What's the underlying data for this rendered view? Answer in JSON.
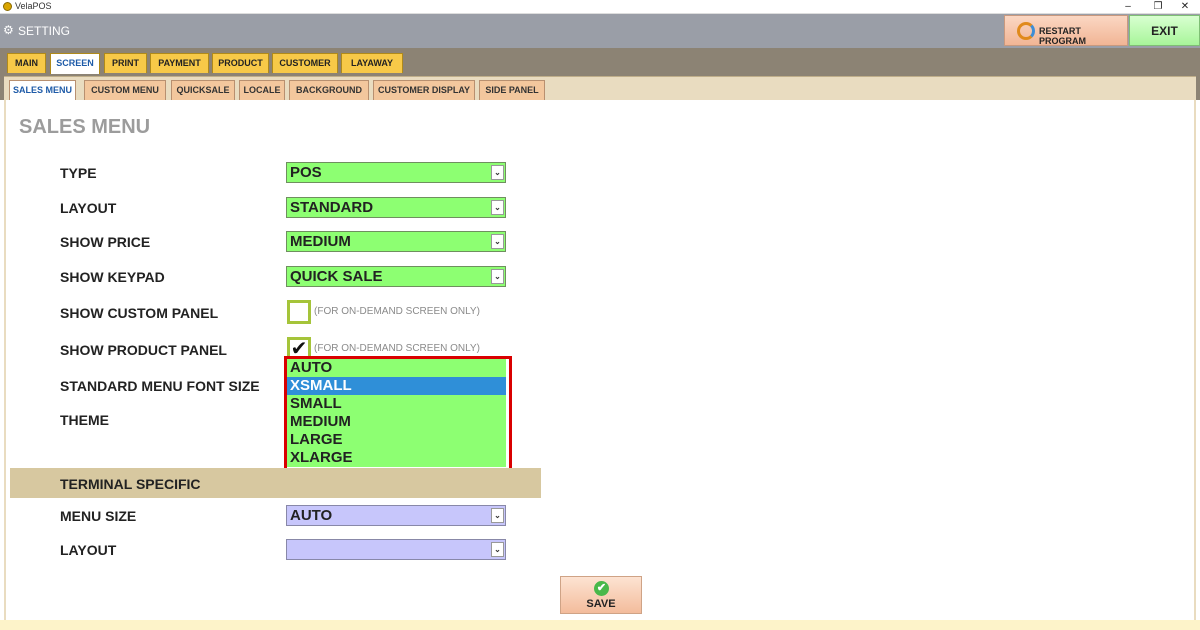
{
  "window": {
    "title": "VelaPOS"
  },
  "header": {
    "title": "SETTING",
    "restart_label": "RESTART PROGRAM",
    "exit_label": "EXIT"
  },
  "main_tabs": [
    "MAIN",
    "SCREEN",
    "PRINT",
    "PAYMENT",
    "PRODUCT",
    "CUSTOMER",
    "LAYAWAY"
  ],
  "active_main_tab": "SCREEN",
  "sub_tabs": [
    "SALES MENU",
    "CUSTOM MENU",
    "QUICKSALE",
    "LOCALE",
    "BACKGROUND",
    "CUSTOMER DISPLAY",
    "SIDE PANEL"
  ],
  "active_sub_tab": "SALES MENU",
  "page_title": "SALES MENU",
  "fields": {
    "type": {
      "label": "TYPE",
      "value": "POS"
    },
    "layout": {
      "label": "LAYOUT",
      "value": "STANDARD"
    },
    "show_price": {
      "label": "SHOW PRICE",
      "value": "MEDIUM"
    },
    "show_keypad": {
      "label": "SHOW KEYPAD",
      "value": "QUICK SALE"
    },
    "show_custom_panel": {
      "label": "SHOW CUSTOM PANEL",
      "checked": false,
      "note": "(FOR ON-DEMAND SCREEN ONLY)"
    },
    "show_product_panel": {
      "label": "SHOW PRODUCT PANEL",
      "checked": true,
      "note": "(FOR ON-DEMAND SCREEN ONLY)",
      "check_mark": "✔"
    },
    "standard_menu_font_size": {
      "label": "STANDARD MENU FONT SIZE"
    },
    "theme": {
      "label": "THEME"
    }
  },
  "font_size_dropdown": {
    "options": [
      "AUTO",
      "XSMALL",
      "SMALL",
      "MEDIUM",
      "LARGE",
      "XLARGE"
    ],
    "highlighted": "XSMALL"
  },
  "terminal_specific": {
    "title": "TERMINAL SPECIFIC",
    "menu_size": {
      "label": "MENU SIZE",
      "value": "AUTO"
    },
    "layout": {
      "label": "LAYOUT",
      "value": ""
    }
  },
  "save_label": "SAVE",
  "icons": {
    "gear": "⚙",
    "chevron": "⌄",
    "save": "✔"
  },
  "colors": {
    "green_field": "#8dff72",
    "lavender_field": "#c7c6fb",
    "highlight": "#2f8fd8",
    "callout": "#d90000"
  }
}
